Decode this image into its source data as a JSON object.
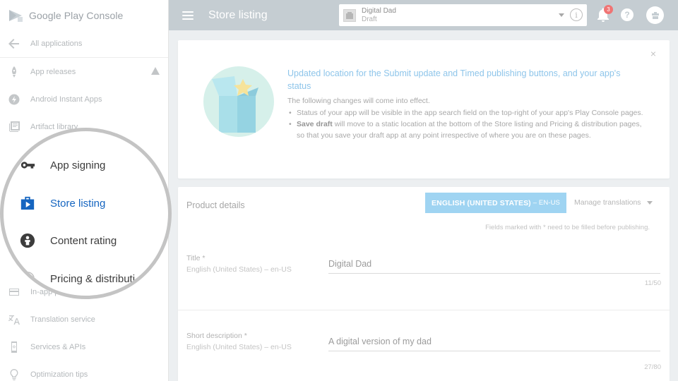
{
  "brand": {
    "name": "Google Play Console"
  },
  "sidebar": {
    "items": [
      {
        "label": "All applications",
        "icon": "arrow-back-icon"
      },
      {
        "label": "App releases",
        "icon": "rocket-icon",
        "warning": true
      },
      {
        "label": "Android Instant Apps",
        "icon": "bolt-icon"
      },
      {
        "label": "Artifact library",
        "icon": "library-icon"
      },
      {
        "label": "In-app products",
        "icon": "card-icon"
      },
      {
        "label": "Translation service",
        "icon": "translate-icon"
      },
      {
        "label": "Services & APIs",
        "icon": "phone-icon"
      },
      {
        "label": "Optimization tips",
        "icon": "bulb-icon"
      }
    ],
    "info_badge": "!"
  },
  "magnifier": {
    "items": [
      {
        "label": "App signing",
        "icon": "key-icon",
        "active": false
      },
      {
        "label": "Store listing",
        "icon": "store-listing-icon",
        "active": true
      },
      {
        "label": "Content rating",
        "icon": "content-rating-icon",
        "active": false
      },
      {
        "label": "Pricing & distributi",
        "icon": "globe-icon",
        "active": false
      }
    ]
  },
  "topbar": {
    "title": "Store listing",
    "app_name": "Digital Dad",
    "app_status": "Draft",
    "notification_count": "3",
    "help_label": "?",
    "info_label": "i"
  },
  "banner": {
    "title": "Updated location for the Submit update and Timed publishing buttons, and your app's status",
    "intro": "The following changes will come into effect.",
    "bullet1": "Status of your app will be visible in the app search field on the top-right of your app's Play Console pages.",
    "bullet2_bold": "Save draft",
    "bullet2_rest": " will move to a static location at the bottom of the Store listing and Pricing & distribution pages, so that you save your draft app at any point irrespective of where you are on these pages.",
    "close_label": "×"
  },
  "product_details": {
    "heading": "Product details",
    "language_button": "ENGLISH (UNITED STATES)",
    "language_code": "– EN-US",
    "manage_translations": "Manage translations",
    "required_note": "Fields marked with * need to be filled before publishing.",
    "fields": [
      {
        "label": "Title *",
        "sublabel": "English (United States) – en-US",
        "value": "Digital Dad",
        "counter": "11/50"
      },
      {
        "label": "Short description *",
        "sublabel": "English (United States) – en-US",
        "value": "A digital version of my dad",
        "counter": "27/80"
      }
    ]
  },
  "colors": {
    "topbar": "#c5cdd2",
    "accent_blue": "#1565c0",
    "language_button": "#9fd4f2",
    "notification_badge": "#f07474"
  }
}
